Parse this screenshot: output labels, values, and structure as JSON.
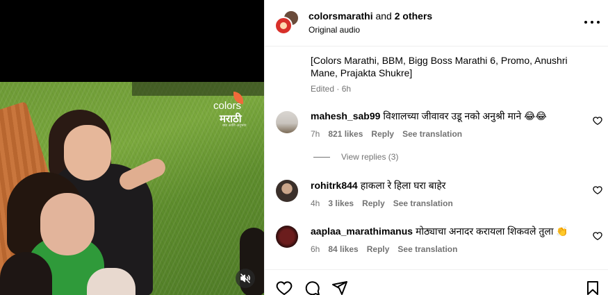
{
  "video": {
    "brand_word": "colors",
    "brand_marathi": "मराठी",
    "brand_tagline": "बघा आणि अनुभवा",
    "mute_icon": "speaker-muted-icon"
  },
  "post_header": {
    "username": "colorsmarathi",
    "and_text": "and",
    "others": "2 others",
    "audio": "Original audio",
    "more_icon": "more-horizontal-icon"
  },
  "caption": {
    "text": "[Colors Marathi, BBM, Bigg Boss Marathi 6, Promo, Anushri Mane, Prajakta Shukre]",
    "time": "Edited · 6h"
  },
  "comments": [
    {
      "username": "mahesh_sab99",
      "text": "विशालच्या जीवावर उडू नको अनुश्री माने 😂😂",
      "time": "7h",
      "likes": "821 likes",
      "reply": "Reply",
      "translate": "See translation"
    },
    {
      "username": "rohitrk844",
      "text": "हाकला रे हिला घरा बाहेर",
      "time": "4h",
      "likes": "3 likes",
      "reply": "Reply",
      "translate": "See translation"
    },
    {
      "username": "aaplaa_marathimanus",
      "text": "मोठ्याचा अनादर करायला शिकवले तुला 👏",
      "time": "6h",
      "likes": "84 likes",
      "reply": "Reply",
      "translate": "See translation"
    }
  ],
  "view_replies": "View replies (3)",
  "actions": {
    "like_icon": "heart-icon",
    "comment_icon": "comment-icon",
    "share_icon": "share-icon",
    "save_icon": "bookmark-icon"
  }
}
